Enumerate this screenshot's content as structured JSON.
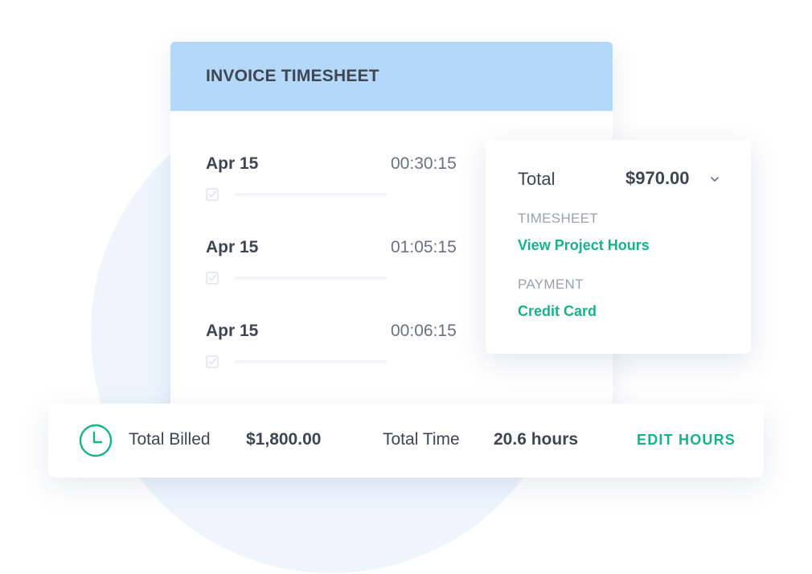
{
  "timesheet": {
    "title": "INVOICE TIMESHEET",
    "entries": [
      {
        "date": "Apr 15",
        "time": "00:30:15"
      },
      {
        "date": "Apr 15",
        "time": "01:05:15"
      },
      {
        "date": "Apr 15",
        "time": "00:06:15"
      }
    ]
  },
  "summary": {
    "total_label": "Total",
    "total_value": "$970.00",
    "timesheet_label": "TIMESHEET",
    "timesheet_link": "View Project Hours",
    "payment_label": "PAYMENT",
    "payment_link": "Credit Card"
  },
  "bottom_bar": {
    "billed_label": "Total Billed",
    "billed_value": "$1,800.00",
    "time_label": "Total Time",
    "time_value": "20.6 hours",
    "edit_label": "EDIT HOURS"
  },
  "colors": {
    "accent": "#16b28c",
    "header_bg": "#b4d9f8",
    "circle_bg": "#eef5fd",
    "text_dark": "#3f4553"
  },
  "icons": [
    "check-square-icon",
    "chevron-down-icon",
    "clock-icon"
  ]
}
